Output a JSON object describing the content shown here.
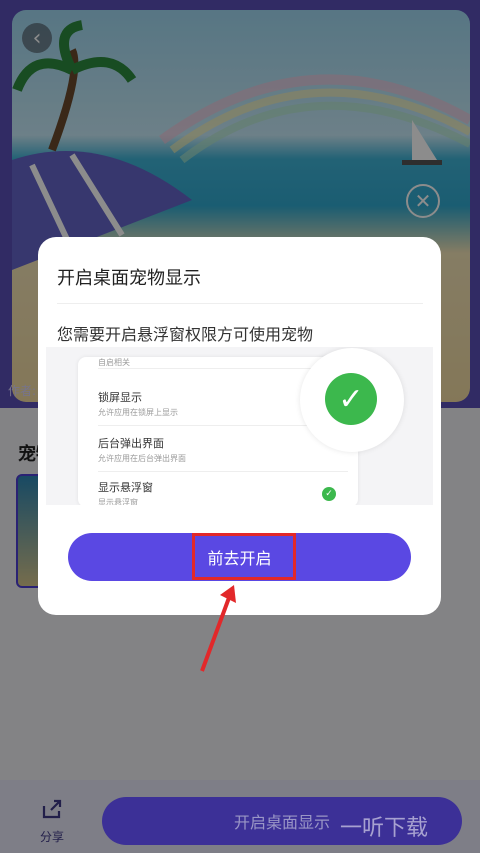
{
  "header": {
    "back_icon": "back-arrow-icon",
    "close_icon": "close-icon"
  },
  "hero": {
    "author_label": "作者:"
  },
  "section": {
    "title": "宠物"
  },
  "dialog": {
    "title": "开启桌面宠物显示",
    "description": "您需要开启悬浮窗权限方可使用宠物",
    "settings": [
      {
        "title": "锁屏显示",
        "subtitle": "允许应用在锁屏上显示"
      },
      {
        "title": "后台弹出界面",
        "subtitle": "允许应用在后台弹出界面"
      },
      {
        "title": "显示悬浮窗",
        "subtitle": "显示悬浮窗"
      }
    ],
    "cropped_header": "自启相关",
    "go_button": "前去开启"
  },
  "bottom": {
    "share_label": "分享",
    "enable_button": "开启桌面显示",
    "watermark": "一听下载"
  },
  "colors": {
    "accent": "#5a48e3",
    "check": "#3cb84d",
    "highlight": "#e2282a"
  }
}
